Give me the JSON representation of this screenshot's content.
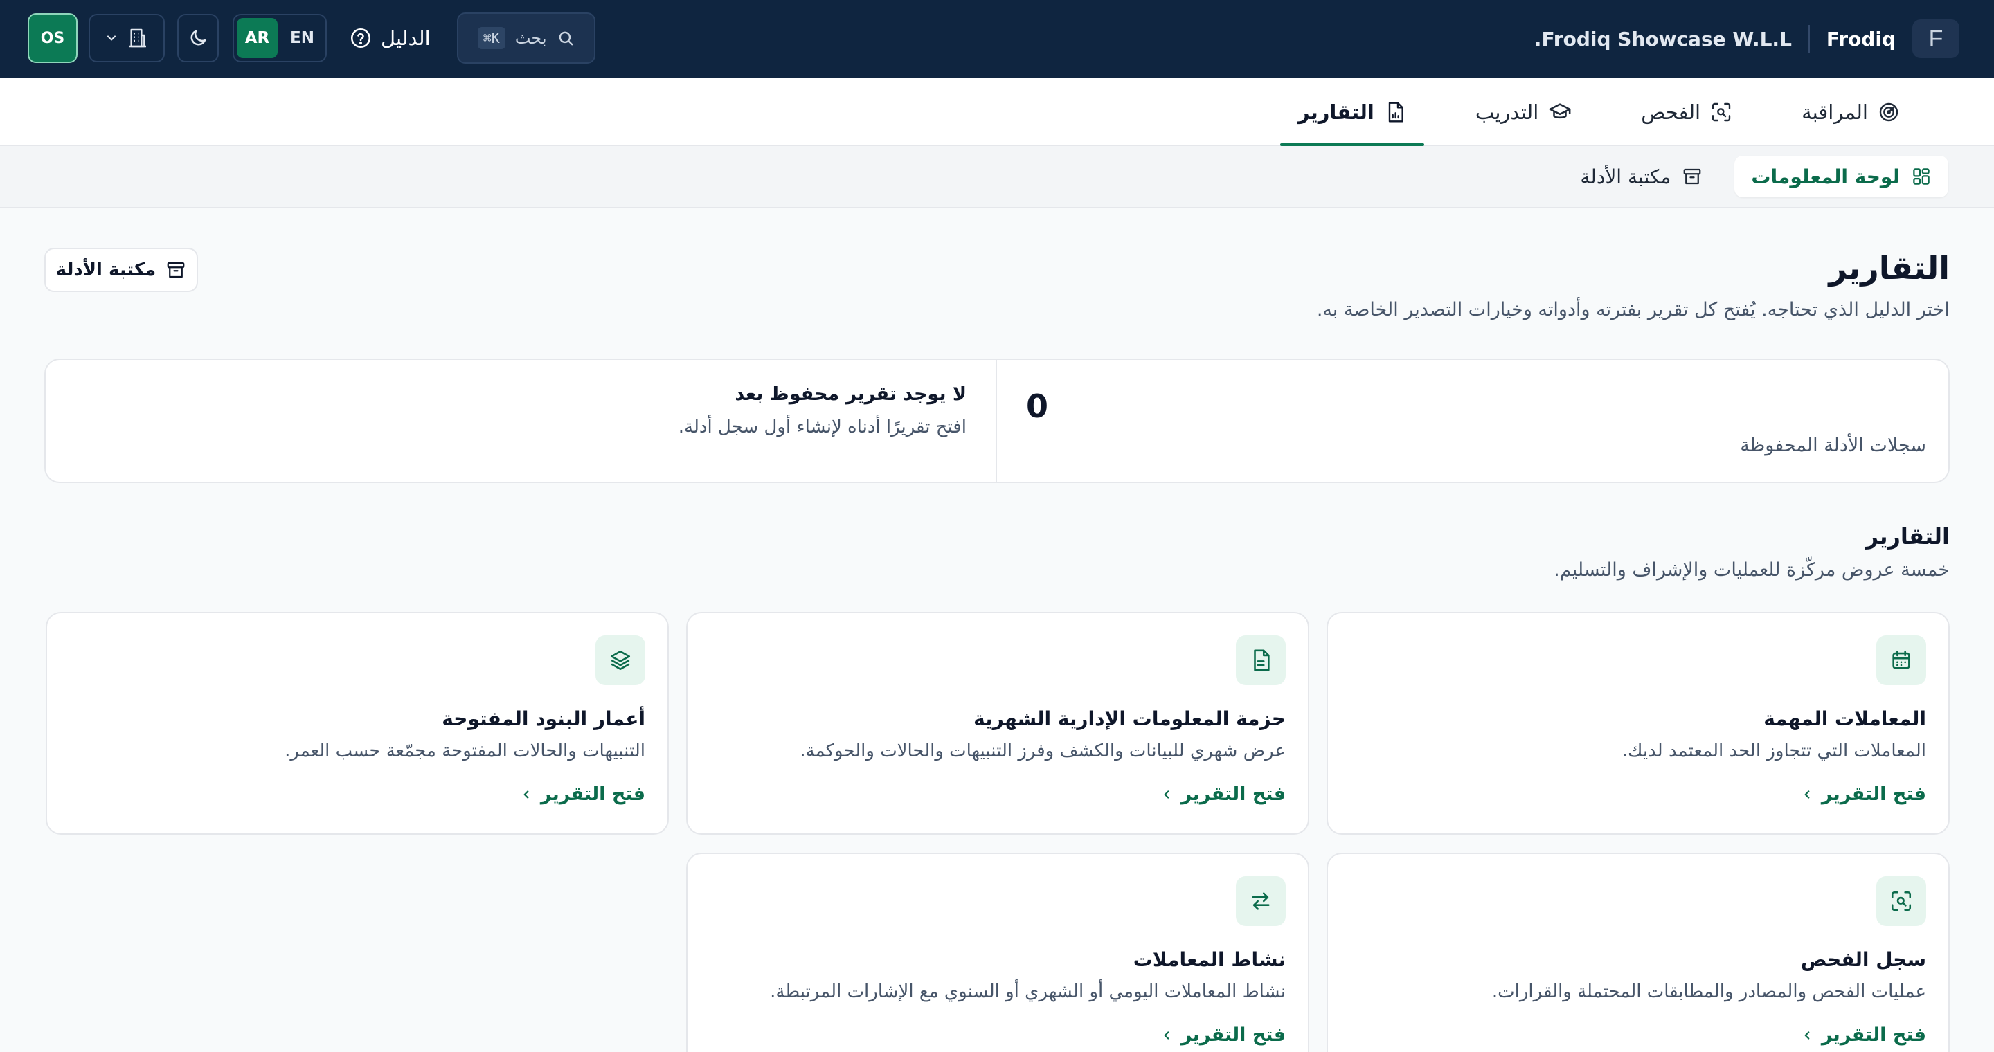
{
  "topbar": {
    "logo_letter": "F",
    "brand_name": "Frodiq",
    "company": "Frodiq Showcase W.L.L.",
    "search_placeholder": "بحث",
    "search_shortcut": "⌘K",
    "guide_label": "الدليل",
    "lang_ar": "AR",
    "lang_en": "EN",
    "active_lang": "AR",
    "user_initials": "OS"
  },
  "tabs": [
    {
      "label": "المراقبة",
      "icon": "radar-icon",
      "active": false
    },
    {
      "label": "الفحص",
      "icon": "scan-icon",
      "active": false
    },
    {
      "label": "التدريب",
      "icon": "graduation-cap-icon",
      "active": false
    },
    {
      "label": "التقارير",
      "icon": "report-file-icon",
      "active": true
    }
  ],
  "subnav": [
    {
      "label": "لوحة المعلومات",
      "icon": "dashboard-grid-icon",
      "active": true
    },
    {
      "label": "مكتبة الأدلة",
      "icon": "archive-icon",
      "active": false
    }
  ],
  "page": {
    "title": "التقارير",
    "subtitle": "اختر الدليل الذي تحتاجه. يُفتح كل تقرير بفترته وأدواته وخيارات التصدير الخاصة به.",
    "evidence_button": "مكتبة الأدلة"
  },
  "stats": {
    "value": "0",
    "label": "سجلات الأدلة المحفوظة",
    "empty_title": "لا يوجد تقرير محفوظ بعد",
    "empty_desc": "افتح تقريرًا أدناه لإنشاء أول سجل أدلة."
  },
  "reports": {
    "title": "التقارير",
    "subtitle": "خمسة عروض مركّزة للعمليات والإشراف والتسليم.",
    "link_label": "فتح التقرير",
    "cards": [
      {
        "title": "المعاملات المهمة",
        "desc": "المعاملات التي تتجاوز الحد المعتمد لديك.",
        "icon": "calendar-icon"
      },
      {
        "title": "حزمة المعلومات الإدارية الشهرية",
        "desc": "عرض شهري للبيانات والكشف وفرز التنبيهات والحالات والحوكمة.",
        "icon": "document-icon"
      },
      {
        "title": "أعمار البنود المفتوحة",
        "desc": "التنبيهات والحالات المفتوحة مجمّعة حسب العمر.",
        "icon": "layers-icon"
      },
      {
        "title": "سجل الفحص",
        "desc": "عمليات الفحص والمصادر والمطابقات المحتملة والقرارات.",
        "icon": "scan-icon"
      },
      {
        "title": "نشاط المعاملات",
        "desc": "نشاط المعاملات اليومي أو الشهري أو السنوي مع الإشارات المرتبطة.",
        "icon": "transfer-arrows-icon"
      }
    ]
  },
  "colors": {
    "topbar": "#0f2540",
    "accent": "#0c7a55",
    "accent_text": "#0b6b4b",
    "icon_bg": "#e6f5ee"
  }
}
